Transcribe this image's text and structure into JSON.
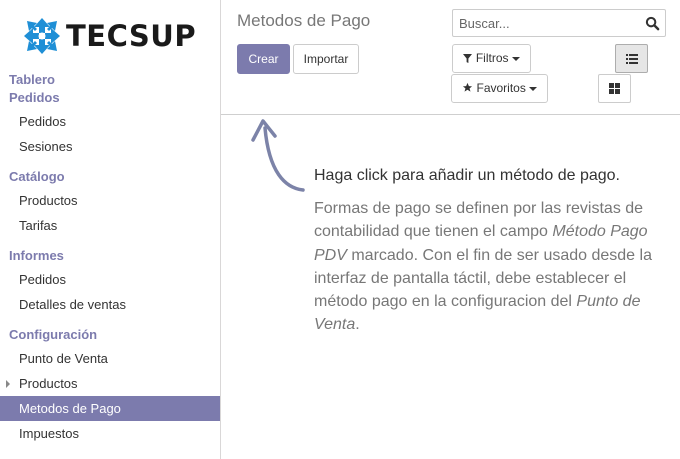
{
  "brand": {
    "logo_text": "TECSUP"
  },
  "sidebar": {
    "sections": [
      {
        "heading": "Tablero"
      },
      {
        "heading": "Pedidos",
        "items": [
          {
            "label": "Pedidos"
          },
          {
            "label": "Sesiones"
          }
        ]
      },
      {
        "heading": "Catálogo",
        "items": [
          {
            "label": "Productos"
          },
          {
            "label": "Tarifas"
          }
        ]
      },
      {
        "heading": "Informes",
        "items": [
          {
            "label": "Pedidos"
          },
          {
            "label": "Detalles de ventas"
          }
        ]
      },
      {
        "heading": "Configuración",
        "items": [
          {
            "label": "Punto de Venta"
          },
          {
            "label": "Productos",
            "expandable": true
          },
          {
            "label": "Metodos de Pago",
            "active": true
          },
          {
            "label": "Impuestos"
          }
        ]
      }
    ]
  },
  "control_panel": {
    "title": "Metodos de Pago",
    "create_label": "Crear",
    "import_label": "Importar",
    "search_placeholder": "Buscar...",
    "filters_label": "Filtros",
    "favorites_label": "Favoritos",
    "active_view": "list"
  },
  "help": {
    "title": "Haga click para añadir un método de pago.",
    "body_1": "Formas de pago se definen por las revistas de contabilidad que tienen el campo ",
    "body_em_1": "Método Pago PDV",
    "body_2": " marcado. Con el fin de ser usado desde la interfaz de pantalla táctil, debe establecer el método pago en la configuracion del ",
    "body_em_2": "Punto de Venta",
    "body_3": "."
  },
  "colors": {
    "accent": "#7c7bad",
    "logo_blue": "#1f8fd6"
  },
  "icons": [
    "tecsup-logo-icon",
    "search-icon",
    "filter-icon",
    "star-icon",
    "list-view-icon",
    "kanban-view-icon",
    "caret-right-icon",
    "curved-arrow-icon"
  ]
}
